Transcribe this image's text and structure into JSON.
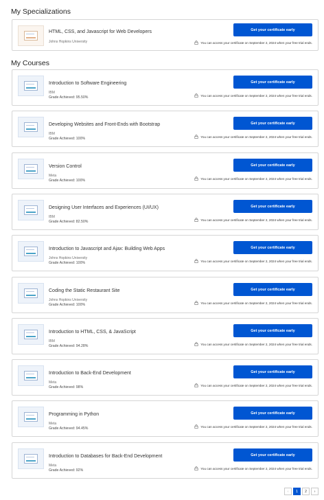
{
  "specializations": {
    "heading": "My Specializations",
    "items": [
      {
        "title": "HTML, CSS, and Javascript for Web Developers",
        "org": "Johns Hopkins University"
      }
    ]
  },
  "courses": {
    "heading": "My Courses",
    "items": [
      {
        "title": "Introduction to Software Engineering",
        "org": "IBM",
        "grade": "Grade Achieved: 95.50%"
      },
      {
        "title": "Developing Websites and Front-Ends with Bootstrap",
        "org": "IBM",
        "grade": "Grade Achieved: 100%"
      },
      {
        "title": "Version Control",
        "org": "Meta",
        "grade": "Grade Achieved: 100%"
      },
      {
        "title": "Designing User Interfaces and Experiences (UI/UX)",
        "org": "IBM",
        "grade": "Grade Achieved: 82.50%"
      },
      {
        "title": "Introduction to Javascript and Ajax: Building Web Apps",
        "org": "Johns Hopkins University",
        "grade": "Grade Achieved: 100%"
      },
      {
        "title": "Coding the Static Restaurant Site",
        "org": "Johns Hopkins University",
        "grade": "Grade Achieved: 100%"
      },
      {
        "title": "Introduction to HTML, CSS, & JavaScript",
        "org": "IBM",
        "grade": "Grade Achieved: 94.28%"
      },
      {
        "title": "Introduction to Back-End Development",
        "org": "Meta",
        "grade": "Grade Achieved: 98%"
      },
      {
        "title": "Programming in Python",
        "org": "Meta",
        "grade": "Grade Achieved: 94.45%"
      },
      {
        "title": "Introduction to Databases for Back-End Development",
        "org": "Meta",
        "grade": "Grade Achieved: 92%"
      }
    ]
  },
  "cta_label": "Get your certificate early",
  "trial_note": "You can access your certificate on September 2, 2024 when your free trial ends.",
  "pagination": {
    "prev": "‹",
    "pages": [
      "1",
      "2"
    ],
    "next": "›",
    "current": "1"
  },
  "colors": {
    "accent": "#0056d2",
    "border": "#d5d5d5"
  }
}
